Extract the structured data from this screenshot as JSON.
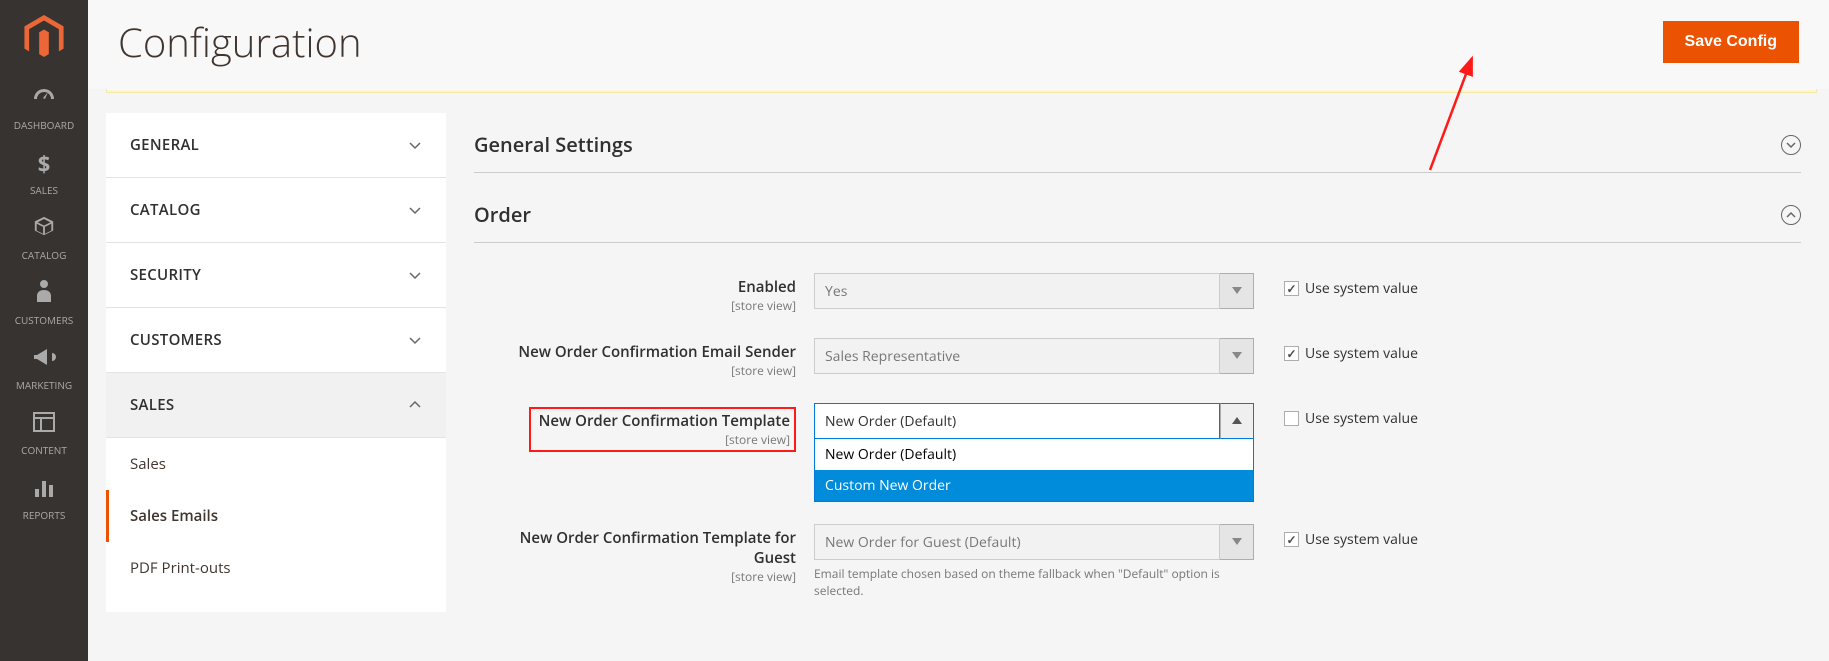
{
  "page": {
    "title": "Configuration",
    "save_label": "Save Config"
  },
  "admin_nav": [
    {
      "icon": "dashboard",
      "label": "DASHBOARD"
    },
    {
      "icon": "dollar",
      "label": "SALES"
    },
    {
      "icon": "box",
      "label": "CATALOG"
    },
    {
      "icon": "person",
      "label": "CUSTOMERS"
    },
    {
      "icon": "megaphone",
      "label": "MARKETING"
    },
    {
      "icon": "layout",
      "label": "CONTENT"
    },
    {
      "icon": "bars",
      "label": "REPORTS"
    }
  ],
  "config_nav": {
    "items": [
      {
        "label": "GENERAL",
        "expanded": false
      },
      {
        "label": "CATALOG",
        "expanded": false
      },
      {
        "label": "SECURITY",
        "expanded": false
      },
      {
        "label": "CUSTOMERS",
        "expanded": false
      },
      {
        "label": "SALES",
        "expanded": true
      }
    ],
    "sub": [
      {
        "label": "Sales",
        "active": false
      },
      {
        "label": "Sales Emails",
        "active": true
      },
      {
        "label": "PDF Print-outs",
        "active": false
      }
    ]
  },
  "sections": {
    "general": {
      "title": "General Settings",
      "collapsed": true
    },
    "order": {
      "title": "Order",
      "collapsed": false
    }
  },
  "fields": {
    "enabled": {
      "label": "Enabled",
      "scope": "[store view]",
      "value": "Yes",
      "use_system": true,
      "use_system_label": "Use system value"
    },
    "sender": {
      "label": "New Order Confirmation Email Sender",
      "scope": "[store view]",
      "value": "Sales Representative",
      "use_system": true,
      "use_system_label": "Use system value"
    },
    "template": {
      "label": "New Order Confirmation Template",
      "scope": "[store view]",
      "value": "New Order (Default)",
      "options": [
        "New Order (Default)",
        "Custom New Order"
      ],
      "selected_option": "Custom New Order",
      "use_system": false,
      "use_system_label": "Use system value"
    },
    "template_guest": {
      "label": "New Order Confirmation Template for Guest",
      "scope": "[store view]",
      "value": "New Order for Guest (Default)",
      "use_system": true,
      "use_system_label": "Use system value",
      "note": "Email template chosen based on theme fallback when \"Default\" option is selected."
    }
  }
}
